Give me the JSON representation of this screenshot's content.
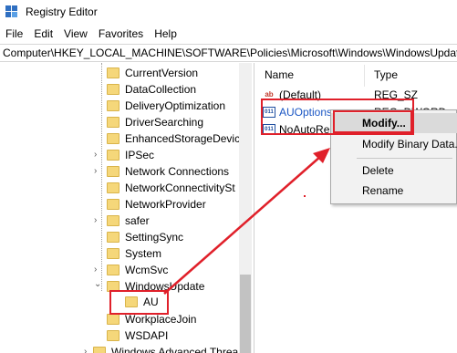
{
  "window": {
    "title": "Registry Editor"
  },
  "menu": [
    "File",
    "Edit",
    "View",
    "Favorites",
    "Help"
  ],
  "address": "Computer\\HKEY_LOCAL_MACHINE\\SOFTWARE\\Policies\\Microsoft\\Windows\\WindowsUpdat",
  "tree": {
    "items": [
      "CurrentVersion",
      "DataCollection",
      "DeliveryOptimization",
      "DriverSearching",
      "EnhancedStorageDevic",
      "IPSec",
      "Network Connections",
      "NetworkConnectivitySt",
      "NetworkProvider",
      "safer",
      "SettingSync",
      "System",
      "WcmSvc",
      "WindowsUpdate",
      "AU",
      "WorkplaceJoin",
      "WSDAPI",
      "Windows Advanced Threa"
    ],
    "expanded_glyph": "⌄",
    "collapsed_glyph": "›"
  },
  "values": {
    "columns": {
      "name": "Name",
      "type": "Type"
    },
    "rows": [
      {
        "name": "(Default)",
        "type": "REG_SZ",
        "icon": "string-value-icon"
      },
      {
        "name": "AUOptions",
        "type": "REG_DWORD",
        "icon": "binary-value-icon"
      },
      {
        "name": "NoAutoRe",
        "type": "",
        "icon": "binary-value-icon"
      }
    ],
    "icon_ab": "ab",
    "icon_bin": "011"
  },
  "context_menu": {
    "items": [
      "Modify...",
      "Modify Binary Data...",
      "Delete",
      "Rename"
    ]
  },
  "colors": {
    "highlight_red": "#e0202a",
    "folder": "#f5d77a"
  }
}
